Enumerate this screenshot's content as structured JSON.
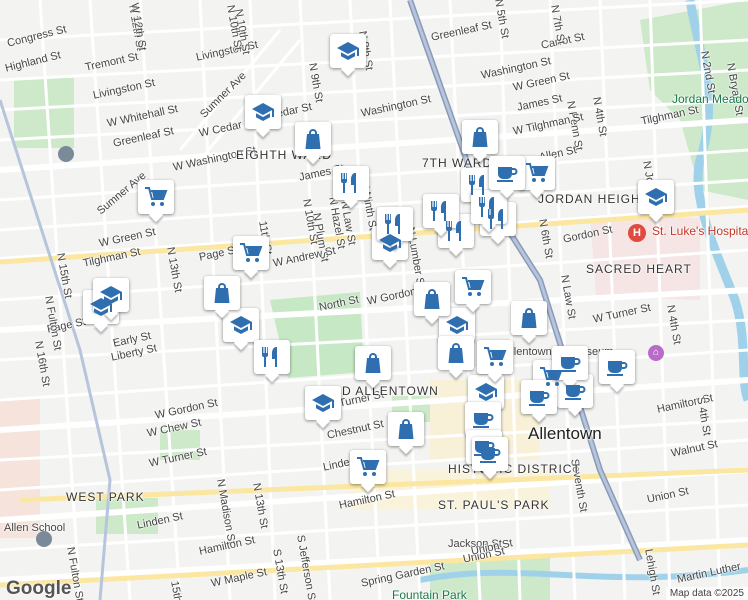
{
  "map": {
    "attribution": "Map data ©2025",
    "logo": "Google",
    "hospital_icon": "H",
    "museum_icon": "⌂",
    "labels": {
      "streets": [
        "Congress St",
        "Highland St",
        "Tremont St",
        "Livingston St",
        "W Whitehall St",
        "Greenleaf St",
        "Sumner Ave",
        "Sumner Ave",
        "W Cedar St",
        "Cedar St",
        "W Washington St",
        "Washington St",
        "Livingston St",
        "N 12th St",
        "N 10th St",
        "N 8th St",
        "N 9th St",
        "James St",
        "W Green St",
        "Tilghman St",
        "Page St",
        "11th St",
        "N 10th St",
        "N Plum St",
        "N Hazel St",
        "N Law St",
        "N Ninth St",
        "W Andrew St",
        "North St",
        "W Gordon St",
        "N Lumber St",
        "Early St",
        "Liberty St",
        "Page St",
        "N Fulton St",
        "N 16th St",
        "N 15th St",
        "N 13th St",
        "W Gordon St",
        "W Chew St",
        "W Turner St",
        "Turner St",
        "Chestnut St",
        "Linden St",
        "Linden St",
        "N Madison St",
        "N 13th St",
        "Hamilton St",
        "Hamilton St",
        "W Maple St",
        "S 13th St",
        "S Jefferson St",
        "15th St",
        "Spring Garden St",
        "Jackson St",
        "Union St",
        "Union St",
        "Hamilton St",
        "Walnut St",
        "S 4th St",
        "N 4th St",
        "N Law St",
        "N 6th St",
        "N Penn St",
        "N 4th St",
        "Seventh St",
        "Greenleaf St",
        "Washington St",
        "Carrot St",
        "James St",
        "W Green St",
        "Allen St",
        "W Tilghman St",
        "Tilghman St",
        "Gordon St",
        "W Turner St",
        "Lehigh St",
        "Martin Luther",
        "N 2nd St",
        "N Bryan St",
        "N Jordan St",
        "N 5th St",
        "N 7th St",
        "N 10th St",
        "W 12th St",
        "Union St",
        "N Fulton St"
      ],
      "districts": [
        "EIGHTH WARD",
        "7TH WARD",
        "JORDAN HEIGHTS",
        "SACRED HEART",
        "OLD ALLENTOWN",
        "HISTORIC DISTRICT",
        "ST. PAUL'S PARK",
        "WEST PARK"
      ],
      "city": "Allentown",
      "parks": [
        "Jordan Meadows",
        "Fountain Park"
      ],
      "places": [
        "St. Luke's Hospitalist Group",
        "Allen School",
        "Allentown Art Museum"
      ]
    },
    "pins": [
      {
        "type": "school"
      },
      {
        "type": "school"
      },
      {
        "type": "school"
      },
      {
        "type": "school"
      },
      {
        "type": "school"
      },
      {
        "type": "school"
      },
      {
        "type": "school"
      },
      {
        "type": "school"
      },
      {
        "type": "school"
      },
      {
        "type": "school"
      },
      {
        "type": "restaurant"
      },
      {
        "type": "restaurant"
      },
      {
        "type": "restaurant"
      },
      {
        "type": "restaurant"
      },
      {
        "type": "restaurant"
      },
      {
        "type": "restaurant"
      },
      {
        "type": "restaurant"
      },
      {
        "type": "restaurant"
      },
      {
        "type": "shop"
      },
      {
        "type": "shop"
      },
      {
        "type": "shop"
      },
      {
        "type": "shop"
      },
      {
        "type": "shop"
      },
      {
        "type": "shop"
      },
      {
        "type": "shop"
      },
      {
        "type": "shop"
      },
      {
        "type": "cart"
      },
      {
        "type": "cart"
      },
      {
        "type": "cart"
      },
      {
        "type": "cart"
      },
      {
        "type": "cart"
      },
      {
        "type": "cart"
      },
      {
        "type": "cart"
      },
      {
        "type": "cafe"
      },
      {
        "type": "cafe"
      },
      {
        "type": "cafe"
      },
      {
        "type": "cafe"
      },
      {
        "type": "cafe"
      },
      {
        "type": "cafe"
      },
      {
        "type": "cafe"
      },
      {
        "type": "cafe"
      }
    ]
  }
}
